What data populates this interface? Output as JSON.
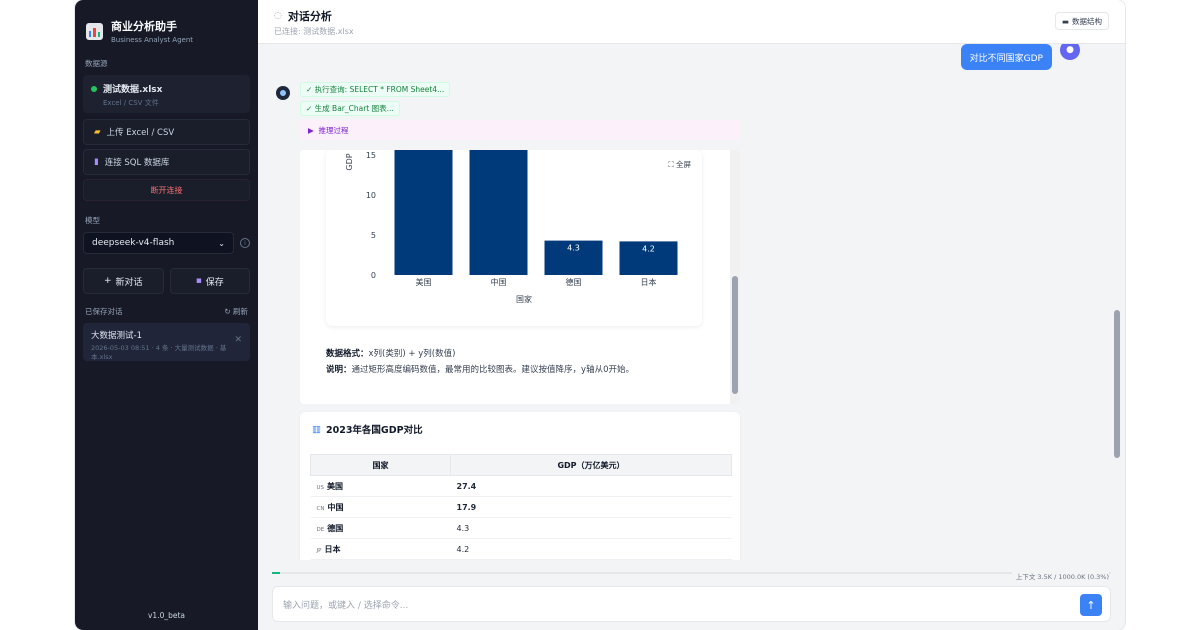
{
  "sidebar": {
    "brand_title": "商业分析助手",
    "brand_sub": "Business Analyst Agent",
    "data_source_label": "数据源",
    "data_source_name": "测试数据.xlsx",
    "data_source_type": "Excel / CSV 文件",
    "upload_label": "上传 Excel / CSV",
    "connect_sql_label": "连接 SQL 数据库",
    "disconnect_label": "断开连接",
    "model_label": "模型",
    "model_value": "deepseek-v4-flash",
    "new_chat_label": "新对话",
    "save_label": "保存",
    "saved_label": "已保存对话",
    "refresh_label": "刷新",
    "saved_item_title": "大数据测试-1",
    "saved_item_meta": "2026-05-03 08:51 · 4 条 · 大量测试数据 · 基本.xlsx",
    "version": "v1.0_beta"
  },
  "header": {
    "title": "对话分析",
    "subtitle": "已连接: 测试数据.xlsx",
    "structure_button": "数据结构"
  },
  "chat": {
    "user_message": "对比不同国家GDP",
    "step_query": "执行查询: SELECT * FROM Sheet4...",
    "step_chart": "生成 Bar_Chart 图表...",
    "reasoning_label": "推理过程",
    "fullscreen_label": "全屏",
    "format_label": "数据格式",
    "format_text": "x列(类别) + y列(数值)",
    "desc_label": "说明",
    "desc_text": "通过矩形高度编码数值，最常用的比较图表。建议按值降序，y轴从0开始。",
    "table_title": "2023年各国GDP对比",
    "table_headers": [
      "国家",
      "GDP（万亿美元）"
    ],
    "table_rows": [
      {
        "code": "US",
        "country": "美国",
        "value": "27.4"
      },
      {
        "code": "CN",
        "country": "中国",
        "value": "17.9"
      },
      {
        "code": "DE",
        "country": "德国",
        "value": "4.3"
      },
      {
        "code": "JP",
        "country": "日本",
        "value": "4.2"
      }
    ]
  },
  "chart_data": {
    "type": "bar",
    "categories": [
      "美国",
      "中国",
      "德国",
      "日本"
    ],
    "values": [
      27.4,
      17.9,
      4.3,
      4.2
    ],
    "data_labels": [
      "",
      "",
      "4.3",
      "4.2"
    ],
    "xlabel": "国家",
    "ylabel": "GDP",
    "visible_ylim": [
      0,
      16
    ],
    "yticks": [
      0,
      5,
      10,
      15
    ],
    "color": "#003a7a"
  },
  "footer": {
    "context_label": "上下文 3.5K / 1000.0K (0.3%)",
    "context_fraction": 0.003,
    "input_placeholder": "输入问题，或键入 / 选择命令..."
  },
  "colors": {
    "accent": "#3b82f6",
    "sidebar_bg": "#171a26",
    "bar": "#003a7a"
  }
}
